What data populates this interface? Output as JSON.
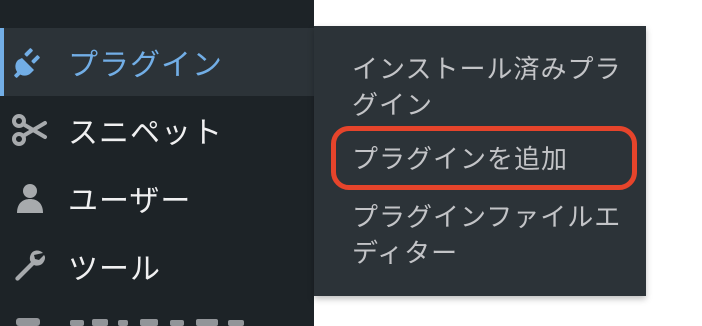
{
  "sidebar": {
    "items": [
      {
        "label": "プラグイン",
        "icon": "plugin-icon",
        "active": true
      },
      {
        "label": "スニペット",
        "icon": "scissors-icon",
        "active": false
      },
      {
        "label": "ユーザー",
        "icon": "user-icon",
        "active": false
      },
      {
        "label": "ツール",
        "icon": "wrench-icon",
        "active": false
      }
    ]
  },
  "submenu": {
    "items": [
      {
        "label": "インストール済みプラグイン"
      },
      {
        "label": "プラグインを追加",
        "highlighted": true
      },
      {
        "label": "プラグインファイルエディター"
      }
    ]
  },
  "colors": {
    "sidebar_bg": "#1d2327",
    "submenu_bg": "#2c3338",
    "active_accent": "#72aee6",
    "highlight_border": "#e6442b",
    "text": "#f0f0f1",
    "submenu_text": "#c3c4c7"
  }
}
